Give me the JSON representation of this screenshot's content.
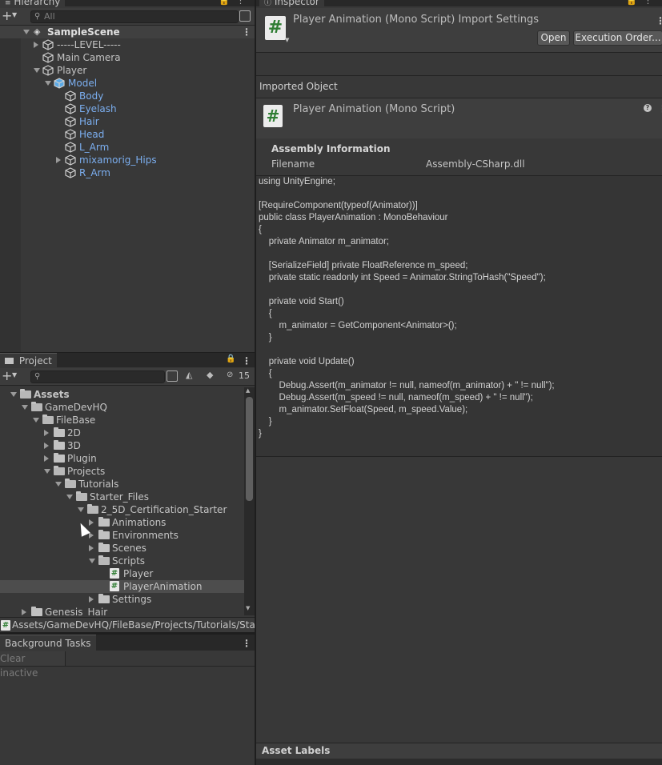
{
  "hierarchy": {
    "tab_label": "Hierarchy",
    "search_placeholder": "All",
    "scene_name": "SampleScene",
    "items": [
      {
        "label": "-----LEVEL-----",
        "blue": false
      },
      {
        "label": "Main Camera",
        "blue": false
      },
      {
        "label": "Player",
        "blue": false
      },
      {
        "label": "Model",
        "blue": true
      },
      {
        "label": "Body",
        "blue": true
      },
      {
        "label": "Eyelash",
        "blue": true
      },
      {
        "label": "Hair",
        "blue": true
      },
      {
        "label": "Head",
        "blue": true
      },
      {
        "label": "L_Arm",
        "blue": true
      },
      {
        "label": "mixamorig_Hips",
        "blue": true
      },
      {
        "label": "R_Arm",
        "blue": true
      }
    ]
  },
  "project": {
    "tab_label": "Project",
    "hidden_count": "15",
    "tree": [
      "Assets",
      "GameDevHQ",
      "FileBase",
      "2D",
      "3D",
      "Plugin",
      "Projects",
      "Tutorials",
      "Starter_Files",
      "2_5D_Certification_Starter",
      "Animations",
      "Environments",
      "Scenes",
      "Scripts",
      "Player",
      "PlayerAnimation",
      "Settings",
      "Genesis_Hair"
    ],
    "path": "Assets/GameDevHQ/FileBase/Projects/Tutorials/Start"
  },
  "background_tasks": {
    "tab_label": "Background Tasks",
    "clear_label": "Clear inactive"
  },
  "inspector": {
    "tab_label": "Inspector",
    "header_title": "Player Animation (Mono Script) Import Settings",
    "open_label": "Open",
    "execution_order_label": "Execution Order...",
    "imported_object_label": "Imported Object",
    "object_title": "Player Animation (Mono Script)",
    "assembly_heading": "Assembly Information",
    "filename_label": "Filename",
    "filename_value": "Assembly-CSharp.dll",
    "code": "using UnityEngine;\n\n[RequireComponent(typeof(Animator))]\npublic class PlayerAnimation : MonoBehaviour\n{\n    private Animator m_animator;\n\n    [SerializeField] private FloatReference m_speed;\n    private static readonly int Speed = Animator.StringToHash(\"Speed\");\n\n    private void Start()\n    {\n        m_animator = GetComponent<Animator>();\n    }\n\n    private void Update()\n    {\n        Debug.Assert(m_animator != null, nameof(m_animator) + \" != null\");\n        Debug.Assert(m_speed != null, nameof(m_speed) + \" != null\");\n        m_animator.SetFloat(Speed, m_speed.Value);\n    }\n}",
    "asset_labels": "Asset Labels"
  },
  "colors": {
    "selected_row": "#4d4d4d",
    "blue_text": "#7baeef",
    "script_icon_green": "#2e7d32"
  }
}
